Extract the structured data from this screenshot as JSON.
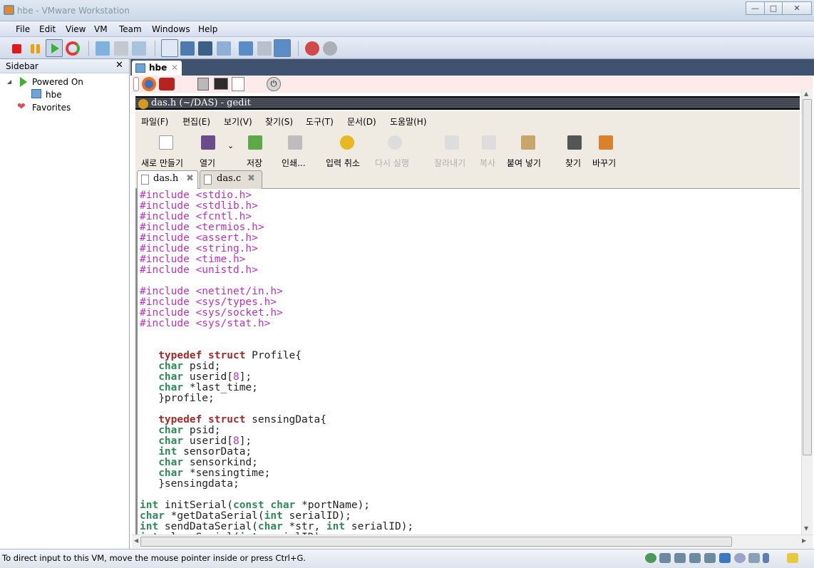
{
  "window": {
    "title": "hbe - VMware Workstation",
    "min": "—",
    "max": "□",
    "close": "✕"
  },
  "menu": [
    "File",
    "Edit",
    "View",
    "VM",
    "Team",
    "Windows",
    "Help"
  ],
  "sidebar": {
    "title": "Sidebar",
    "close": "✕",
    "items": [
      {
        "label": "Powered On"
      },
      {
        "label": "hbe"
      },
      {
        "label": "Favorites"
      }
    ]
  },
  "vm_tab": {
    "label": "hbe",
    "close": "✕"
  },
  "gedit": {
    "title": "das.h (~/DAS) - gedit",
    "menu": [
      "파일(F)",
      "편집(E)",
      "보기(V)",
      "찾기(S)",
      "도구(T)",
      "문서(D)",
      "도움말(H)"
    ],
    "toolbar": [
      {
        "label": "새로 만들기",
        "enabled": true
      },
      {
        "label": "열기",
        "enabled": true
      },
      {
        "label": "저장",
        "enabled": true
      },
      {
        "label": "인쇄...",
        "enabled": true
      },
      {
        "label": "입력 취소",
        "enabled": true
      },
      {
        "label": "다시 실행",
        "enabled": false
      },
      {
        "label": "잘라내기",
        "enabled": false
      },
      {
        "label": "복사",
        "enabled": false
      },
      {
        "label": "붙여 넣기",
        "enabled": true
      },
      {
        "label": "찾기",
        "enabled": true
      },
      {
        "label": "바꾸기",
        "enabled": true
      }
    ],
    "tabs": [
      {
        "label": "das.h",
        "active": true
      },
      {
        "label": "das.c",
        "active": false
      }
    ],
    "code": [
      [
        [
          "pp",
          "#include <stdio.h>"
        ]
      ],
      [
        [
          "pp",
          "#include <stdlib.h>"
        ]
      ],
      [
        [
          "pp",
          "#include <fcntl.h>"
        ]
      ],
      [
        [
          "pp",
          "#include <termios.h>"
        ]
      ],
      [
        [
          "pp",
          "#include <assert.h>"
        ]
      ],
      [
        [
          "pp",
          "#include <string.h>"
        ]
      ],
      [
        [
          "pp",
          "#include <time.h>"
        ]
      ],
      [
        [
          "pp",
          "#include <unistd.h>"
        ]
      ],
      [],
      [
        [
          "pp",
          "#include <netinet/in.h>"
        ]
      ],
      [
        [
          "pp",
          "#include <sys/types.h>"
        ]
      ],
      [
        [
          "pp",
          "#include <sys/socket.h>"
        ]
      ],
      [
        [
          "pp",
          "#include <sys/stat.h>"
        ]
      ],
      [],
      [],
      [
        [
          "plain",
          "   "
        ],
        [
          "kw",
          "typedef"
        ],
        [
          "plain",
          " "
        ],
        [
          "kw",
          "struct"
        ],
        [
          "plain",
          " Profile{"
        ]
      ],
      [
        [
          "plain",
          "   "
        ],
        [
          "type",
          "char"
        ],
        [
          "plain",
          " psid;"
        ]
      ],
      [
        [
          "plain",
          "   "
        ],
        [
          "type",
          "char"
        ],
        [
          "plain",
          " userid["
        ],
        [
          "num",
          "8"
        ],
        [
          "plain",
          "];"
        ]
      ],
      [
        [
          "plain",
          "   "
        ],
        [
          "type",
          "char"
        ],
        [
          "plain",
          " *last_time;"
        ]
      ],
      [
        [
          "plain",
          "   }profile;"
        ]
      ],
      [],
      [
        [
          "plain",
          "   "
        ],
        [
          "kw",
          "typedef"
        ],
        [
          "plain",
          " "
        ],
        [
          "kw",
          "struct"
        ],
        [
          "plain",
          " sensingData{"
        ]
      ],
      [
        [
          "plain",
          "   "
        ],
        [
          "type",
          "char"
        ],
        [
          "plain",
          " psid;"
        ]
      ],
      [
        [
          "plain",
          "   "
        ],
        [
          "type",
          "char"
        ],
        [
          "plain",
          " userid["
        ],
        [
          "num",
          "8"
        ],
        [
          "plain",
          "];"
        ]
      ],
      [
        [
          "plain",
          "   "
        ],
        [
          "type",
          "int"
        ],
        [
          "plain",
          " sensorData;"
        ]
      ],
      [
        [
          "plain",
          "   "
        ],
        [
          "type",
          "char"
        ],
        [
          "plain",
          " sensorkind;"
        ]
      ],
      [
        [
          "plain",
          "   "
        ],
        [
          "type",
          "char"
        ],
        [
          "plain",
          " *sensingtime;"
        ]
      ],
      [
        [
          "plain",
          "   }sensingdata;"
        ]
      ],
      [],
      [
        [
          "type",
          "int"
        ],
        [
          "plain",
          " initSerial("
        ],
        [
          "type",
          "const"
        ],
        [
          "plain",
          " "
        ],
        [
          "type",
          "char"
        ],
        [
          "plain",
          " *portName);"
        ]
      ],
      [
        [
          "type",
          "char"
        ],
        [
          "plain",
          " *getDataSerial("
        ],
        [
          "type",
          "int"
        ],
        [
          "plain",
          " serialID);"
        ]
      ],
      [
        [
          "type",
          "int"
        ],
        [
          "plain",
          " sendDataSerial("
        ],
        [
          "type",
          "char"
        ],
        [
          "plain",
          " *str, "
        ],
        [
          "type",
          "int"
        ],
        [
          "plain",
          " serialID);"
        ]
      ],
      [
        [
          "type",
          "int"
        ],
        [
          "plain",
          " closeSerial("
        ],
        [
          "type",
          "int"
        ],
        [
          "plain",
          " serialID);"
        ]
      ]
    ]
  },
  "status": {
    "text": "To direct input to this VM, move the mouse pointer inside or press Ctrl+G."
  },
  "colors": {
    "preprocessor": "#c030c0",
    "keyword": "#a52a2a",
    "type": "#2e8b57",
    "vm_tab_strip": "#3f5270",
    "panel": "#fdeaea"
  }
}
